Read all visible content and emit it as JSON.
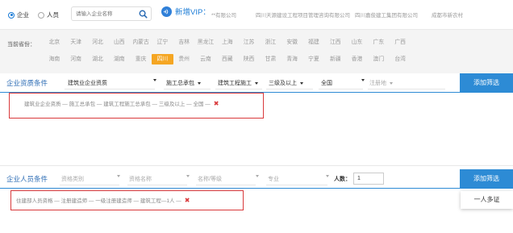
{
  "top": {
    "radio_company": "企业",
    "radio_person": "人员",
    "search_placeholder": "请输入企业名称",
    "vip_label": "新增VIP：",
    "vip_companies": [
      "**有限公司",
      "四川天源建设工程项目管理咨询有限公司",
      "四川嘉俊建工集团有限公司",
      "成都市新农村"
    ]
  },
  "provinces": {
    "label": "当前省份：",
    "row1": [
      "北京",
      "天津",
      "河北",
      "山西",
      "内蒙古",
      "辽宁",
      "吉林",
      "黑龙江",
      "上海",
      "江苏",
      "浙江",
      "安徽",
      "福建",
      "江西",
      "山东",
      "广东",
      "广西"
    ],
    "row2": [
      "海南",
      "河南",
      "湖北",
      "湖南",
      "重庆",
      "四川",
      "贵州",
      "云南",
      "西藏",
      "陕西",
      "甘肃",
      "青海",
      "宁夏",
      "新疆",
      "香港",
      "澳门",
      "台湾"
    ],
    "active": "四川"
  },
  "qualification": {
    "title": "企业资质条件",
    "selects": [
      "建筑业企业资质",
      "施工总承包",
      "建筑工程施工",
      "三级及以上",
      "全国",
      "注册地"
    ],
    "add_button": "添加筛选",
    "result": "建筑业企业资质 — 施工总承包 — 建筑工程施工总承包 — 三级及以上 — 全国 —"
  },
  "personnel": {
    "title": "企业人员条件",
    "selects": [
      "资格类别",
      "资格名称",
      "名称/等级",
      "专业"
    ],
    "count_label": "人数：",
    "count_value": "1",
    "add_button": "添加筛选",
    "result": "住建部人员资格 — 注册建造师 — 一级注册建造师 — 建筑工程—1人 —",
    "dropdown": "一人多证"
  },
  "colors": {
    "accent": "#2d8bd5",
    "active_province": "#f5a623",
    "highlight_box": "#d9393b"
  }
}
